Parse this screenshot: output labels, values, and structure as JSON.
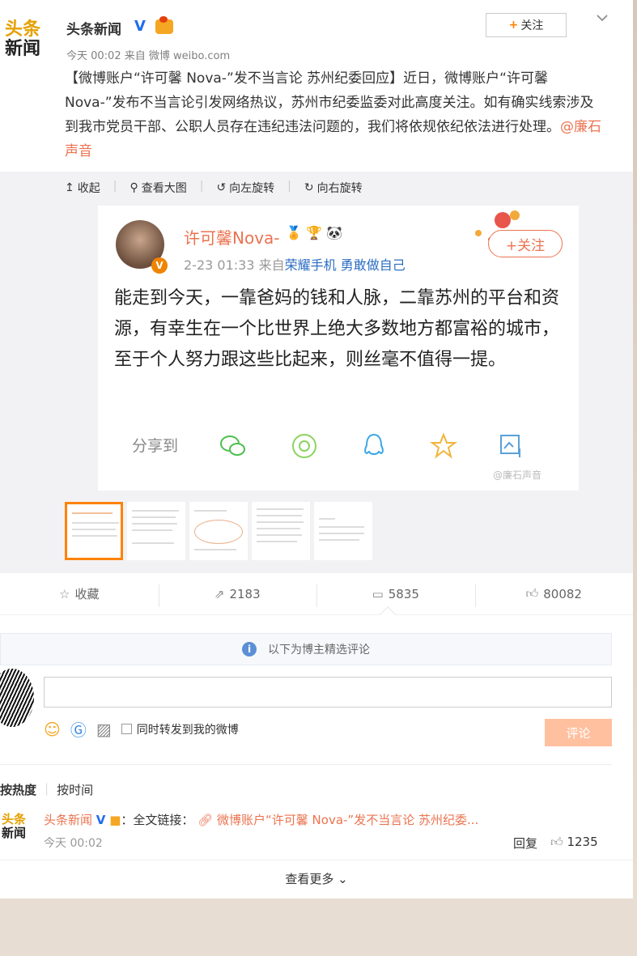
{
  "header": {
    "logo_top": "头条",
    "logo_bottom": "新闻",
    "author": "头条新闻",
    "verified": "V",
    "follow_plus": "+",
    "follow_label": "关注",
    "time_source": "今天 00:02 来自 微博 weibo.com"
  },
  "post": {
    "text": "【微博账户“许可馨 Nova-”发不当言论 苏州纪委回应】近日，微博账户“许可馨Nova-”发布不当言论引发网络热议，苏州市纪委监委对此高度关注。如有确实线索涉及到我市党员干部、公职人员存在违纪违法问题的，我们将依规依纪依法进行处理。",
    "mention": "@廉石声音"
  },
  "toolbar": {
    "collapse": "收起",
    "view_large": "查看大图",
    "rotate_left": "向左旋转",
    "rotate_right": "向右旋转"
  },
  "screenshot": {
    "name": "许可馨Nova-",
    "time": "2-23 01:33",
    "source_prefix": "来自",
    "source": "荣耀手机 勇敢做自己",
    "follow": "+关注",
    "text": "能走到今天，一靠爸妈的钱和人脉，二靠苏州的平台和资源，有幸生在一个比世界上绝大多数地方都富裕的城市，至于个人努力跟这些比起来，则丝毫不值得一提。",
    "share": "分享到"
  },
  "actions": {
    "favorite": "收藏",
    "reposts": "2183",
    "comments": "5835",
    "likes": "80082"
  },
  "comments": {
    "picked_notice": "以下为博主精选评论",
    "input_placeholder": "",
    "also_post": "同时转发到我的微博",
    "submit": "评论",
    "sort_hot": "按热度",
    "sort_time": "按时间",
    "items": [
      {
        "logo_top": "头条",
        "logo_bottom": "新闻",
        "author": "头条新闻",
        "verified": "V",
        "prefix": "：全文链接：",
        "link": "微博账户“许可馨 Nova-”发不当言论 苏州纪委...",
        "time": "今天 00:02",
        "reply": "回复",
        "likes": "1235"
      }
    ],
    "see_more": "查看更多"
  }
}
